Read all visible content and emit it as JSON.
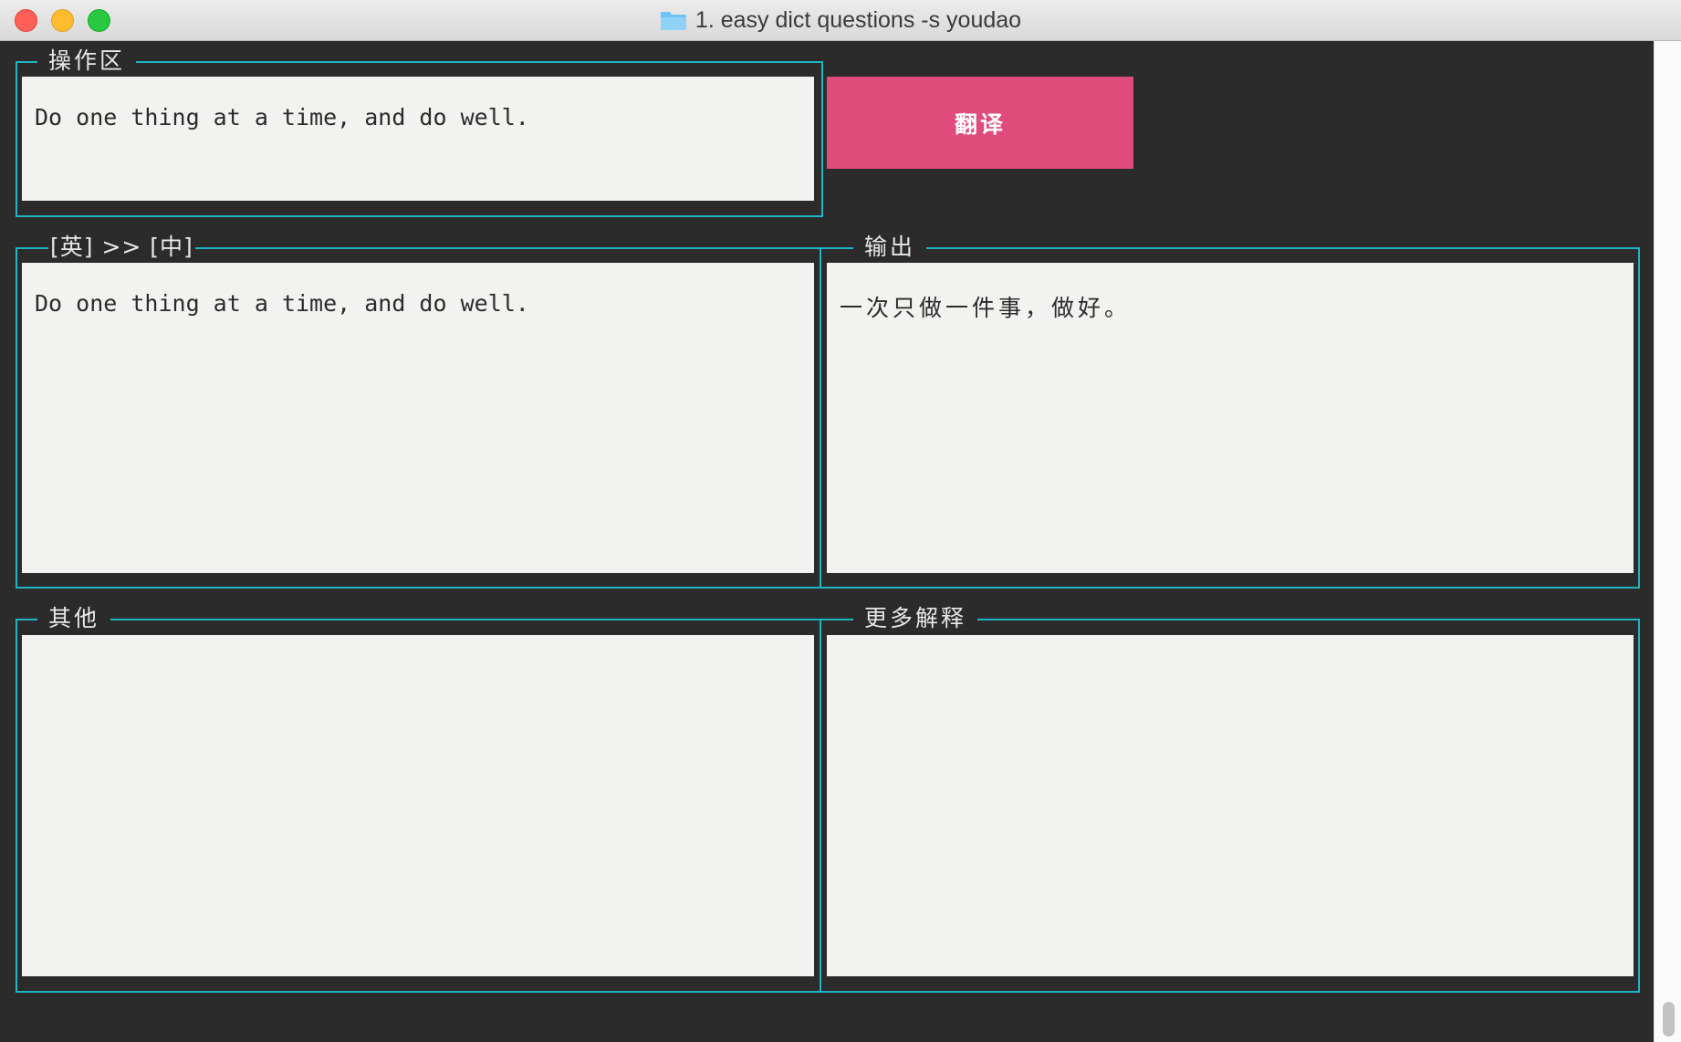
{
  "window": {
    "title": "1. easy dict questions -s youdao",
    "folder_icon": "folder-icon"
  },
  "operation": {
    "legend": "操作区",
    "input_text": "Do one thing at a time, and do well.",
    "translate_button": "翻译"
  },
  "source": {
    "legend": "[英] >> [中]",
    "text": "Do one thing at a time, and do well."
  },
  "output": {
    "legend": "输出",
    "text": "一次只做一件事，做好。"
  },
  "other": {
    "legend": "其他",
    "text": ""
  },
  "more": {
    "legend": "更多解释",
    "text": ""
  },
  "colors": {
    "accent": "#1fb5c4",
    "button": "#df4b7b",
    "background": "#2b2b2b",
    "pane": "#f2f2f1"
  }
}
